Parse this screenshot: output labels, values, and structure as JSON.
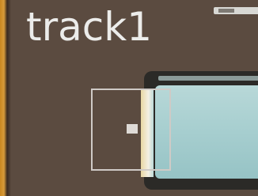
{
  "track": {
    "name": "track1"
  },
  "colors": {
    "track_background": "#5b4b40",
    "track_label": "#ececea",
    "accent_edge": "#d89a3a",
    "clip_fill": "#a8cfd0",
    "selection_outline": "#cfcac6"
  },
  "icons": {
    "anchor": "square-handle-icon"
  }
}
